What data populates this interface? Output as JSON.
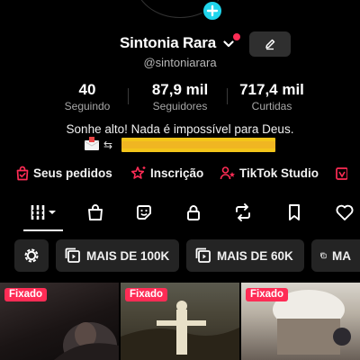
{
  "profile": {
    "name": "Sintonia Rara",
    "handle": "@sintoniarara",
    "bio_line1": "Sonhe alto! Nada é impossível para Deus.",
    "colors": {
      "accent": "#fe2c55",
      "badge": "#20d5ec",
      "highlight": "#f3c51a"
    }
  },
  "stats": [
    {
      "value": "40",
      "label": "Seguindo"
    },
    {
      "value": "87,9 mil",
      "label": "Seguidores"
    },
    {
      "value": "717,4 mil",
      "label": "Curtidas"
    }
  ],
  "links": [
    {
      "label": "Seus pedidos",
      "icon": "shopping-bag-check-icon"
    },
    {
      "label": "Inscrição",
      "icon": "star-sparkle-icon"
    },
    {
      "label": "TikTok Studio",
      "icon": "person-star-icon"
    }
  ],
  "tabs": [
    {
      "icon": "grid-icon",
      "selected": true
    },
    {
      "icon": "shop-bag-icon"
    },
    {
      "icon": "sticker-icon"
    },
    {
      "icon": "lock-icon"
    },
    {
      "icon": "repost-icon"
    },
    {
      "icon": "bookmark-icon"
    },
    {
      "icon": "heart-icon"
    }
  ],
  "filters": [
    {
      "icon": "gear-icon"
    },
    {
      "label": "MAIS DE 100K",
      "icon": "play-stack-icon"
    },
    {
      "label": "MAIS DE 60K",
      "icon": "play-stack-icon"
    },
    {
      "label": "MA",
      "icon": "play-stack-icon"
    }
  ],
  "videos": [
    {
      "badge": "Fixado"
    },
    {
      "badge": "Fixado"
    },
    {
      "badge": "Fixado"
    }
  ]
}
